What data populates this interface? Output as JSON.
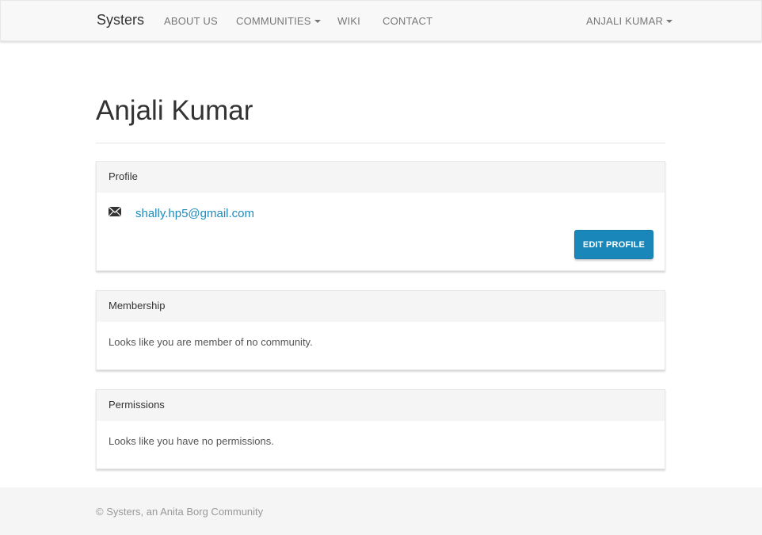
{
  "navbar": {
    "brand": "Systers",
    "items": [
      {
        "label": "ABOUT US"
      },
      {
        "label": "COMMUNITIES"
      },
      {
        "label": "WIKI"
      },
      {
        "label": "CONTACT"
      }
    ],
    "user_menu": "ANJALI KUMAR"
  },
  "page": {
    "title": "Anjali Kumar"
  },
  "profile": {
    "heading": "Profile",
    "email": "shally.hp5@gmail.com",
    "edit_button": "EDIT PROFILE"
  },
  "membership": {
    "heading": "Membership",
    "text": "Looks like you are member of no community."
  },
  "permissions": {
    "heading": "Permissions",
    "text": "Looks like you have no permissions."
  },
  "footer": {
    "text": "© Systers, an Anita Borg Community"
  },
  "colors": {
    "accent": "#1a87ba",
    "link": "#1d8bbd",
    "navbar_bg": "#f8f8f8"
  },
  "icons": {
    "email": "envelope-icon",
    "dropdown": "caret-down-icon"
  }
}
